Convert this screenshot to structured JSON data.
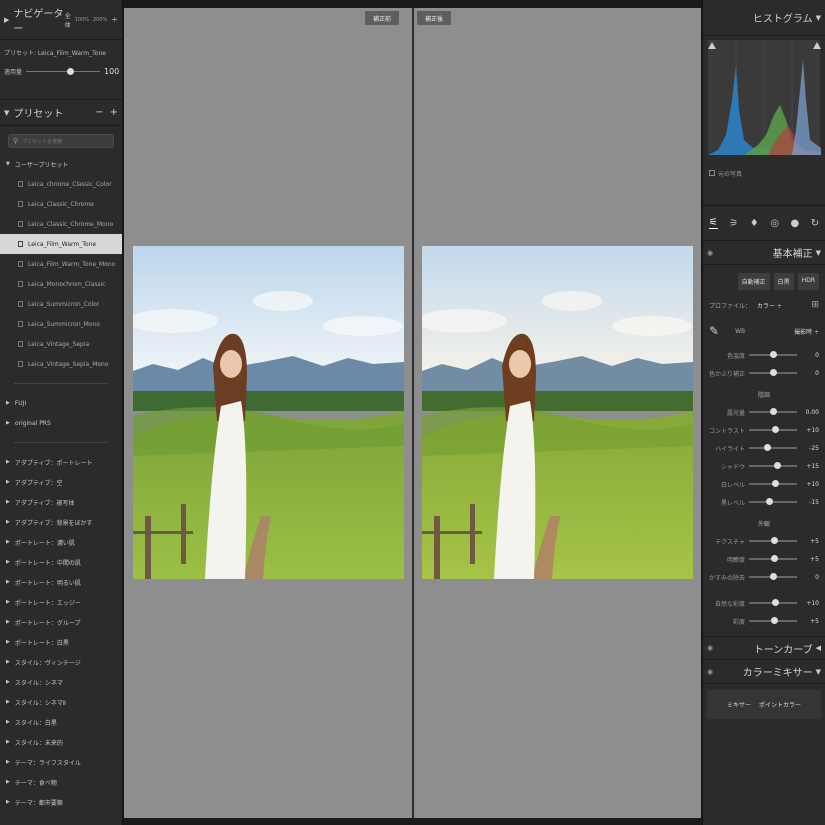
{
  "navigator": {
    "title": "ナビゲーター",
    "zoom_fit": "全体",
    "zoom_100": "100%",
    "zoom_200": "200%"
  },
  "preset_info": {
    "preset_label": "プリセット: Leica_Film_Warm_Tone",
    "amount_label": "適用量",
    "amount_value": "100"
  },
  "presets": {
    "title": "プリセット",
    "minus": "−",
    "plus": "+",
    "search_placeholder": "プリセットを検索",
    "user_group": "ユーザープリセット",
    "user_items": [
      "Leica_chrome_Classic_Color",
      "Leica_Classic_Chrome",
      "Leica_Classic_Chrome_Mono",
      "Leica_Film_Warm_Tone",
      "Leica_Film_Warm_Tone_Mono",
      "Leica_Monochrom_Classic",
      "Leica_Summicron_Color",
      "Leica_Summicron_Mono",
      "Leica_Vintage_Sepia",
      "Leica_Vintage_Sepia_Mono"
    ],
    "selected_index": 3,
    "groups_a": [
      "FUJI",
      "original PRS"
    ],
    "groups_b": [
      "アダプティブ：ポートレート",
      "アダプティブ：空",
      "アダプティブ：被写体",
      "アダプティブ：背景をぼかす",
      "ポートレート：濃い肌",
      "ポートレート：中間の肌",
      "ポートレート：明るい肌",
      "ポートレート：エッジー",
      "ポートレート：グループ",
      "ポートレート：白黒",
      "スタイル：ヴィンテージ",
      "スタイル：シネマ",
      "スタイル：シネマⅡ",
      "スタイル：白黒",
      "スタイル：未来的",
      "テーマ：ライフスタイル",
      "テーマ：食べ物",
      "テーマ：都市要築"
    ]
  },
  "center": {
    "before_label": "補正前",
    "after_label": "補正後"
  },
  "histogram": {
    "title": "ヒストグラム",
    "original_photo": "元の写真"
  },
  "basic": {
    "title": "基本補正",
    "auto_btn": "自動補正",
    "bw_btn": "白黒",
    "hdr_btn": "HDR",
    "profile_label": "プロファイル：",
    "profile_value": "カラー ÷",
    "wb_label": "WB",
    "wb_value": "撮影時 ÷",
    "temp_sliders": [
      {
        "label": "色温度",
        "value": "0",
        "pos": 0.5
      },
      {
        "label": "色かぶり補正",
        "value": "0",
        "pos": 0.5
      }
    ],
    "tone_title": "階調",
    "tone_sliders": [
      {
        "label": "露光量",
        "value": "0.00",
        "pos": 0.5
      },
      {
        "label": "コントラスト",
        "value": "+10",
        "pos": 0.55
      },
      {
        "label": "ハイライト",
        "value": "-25",
        "pos": 0.38
      },
      {
        "label": "シャドウ",
        "value": "+15",
        "pos": 0.58
      },
      {
        "label": "白レベル",
        "value": "+10",
        "pos": 0.55
      },
      {
        "label": "黒レベル",
        "value": "-15",
        "pos": 0.42
      }
    ],
    "presence_title": "外観",
    "presence_sliders": [
      {
        "label": "テクスチャ",
        "value": "+5",
        "pos": 0.53
      },
      {
        "label": "明瞭度",
        "value": "+5",
        "pos": 0.53
      },
      {
        "label": "かすみの除去",
        "value": "0",
        "pos": 0.5
      }
    ],
    "color_sliders": [
      {
        "label": "自然な彩度",
        "value": "+10",
        "pos": 0.55
      },
      {
        "label": "彩度",
        "value": "+5",
        "pos": 0.53
      }
    ]
  },
  "tone_curve": {
    "title": "トーンカーブ"
  },
  "color_mixer": {
    "title": "カラーミキサー",
    "mixer_btn": "ミキサー",
    "point_btn": "ポイントカラー"
  }
}
